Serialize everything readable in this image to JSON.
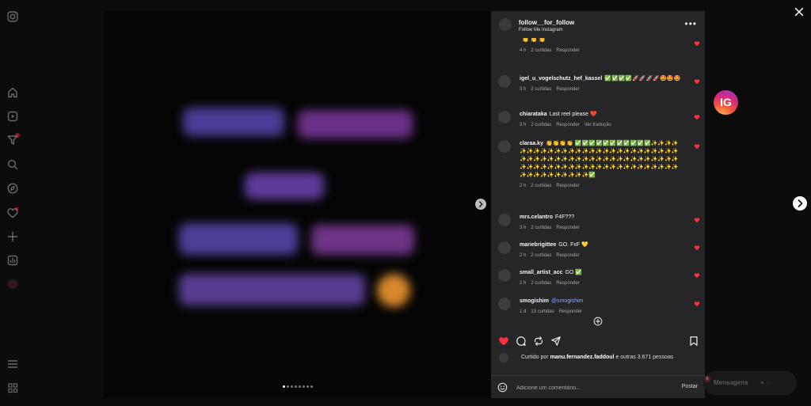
{
  "post": {
    "username": "follow__for_follow",
    "subtitle": "Follow Me Instagram",
    "media_position": {
      "current": 1,
      "total": 8
    }
  },
  "comments": [
    {
      "user": "",
      "text": "",
      "emoji": "👏 👏 👏",
      "time": "4 h",
      "likes": "2 curtidas",
      "reply": "Responder",
      "translate": ""
    },
    {
      "user": "igel_u_vogelschutz_hef_kassel",
      "text": "✅✅✅✅🚀🚀🚀🚀🤩🤩🤩",
      "emoji": "",
      "time": "3 h",
      "likes": "2 curtidas",
      "reply": "Responder",
      "translate": ""
    },
    {
      "user": "chiarataka",
      "text": "Last reel please ❤️",
      "emoji": "",
      "time": "3 h",
      "likes": "2 curtidas",
      "reply": "Responder",
      "translate": "Ver tradução"
    },
    {
      "user": "claraa.ky",
      "text": "👏👏👏👏 ✅✅✅✅✅✅✅✅✅✅✅✨✨✨✨✨✨✨✨✨✨✨✨✨✨✨✨✨✨✨✨✨✨✨✨✨✨✨✨✨✨✨✨✨✨✨✨✨✨✨✨✨✨✨✨✨✨✨✨✨✨✨✨✨✨✨✨✨✨✨✨✨✨✨✨✨✨✨✨✨✨✨✨✨✨✨✨✨✨✨✨✨✨✨✅",
      "emoji": "",
      "time": "2 h",
      "likes": "2 curtidas",
      "reply": "Responder",
      "translate": ""
    },
    {
      "user": "mrs.celantro",
      "text": "F4F???",
      "emoji": "",
      "time": "3 h",
      "likes": "2 curtidas",
      "reply": "Responder",
      "translate": ""
    },
    {
      "user": "mariebrigittee",
      "text": "GO. FxF 💛",
      "emoji": "",
      "time": "2 h",
      "likes": "2 curtidas",
      "reply": "Responder",
      "translate": ""
    },
    {
      "user": "small_artist_acc",
      "text": "GO ✅",
      "emoji": "",
      "time": "2 h",
      "likes": "2 curtidas",
      "reply": "Responder",
      "translate": ""
    },
    {
      "user": "smogishim",
      "text": "@smogishim",
      "emoji": "",
      "time": "1 d",
      "likes": "13 curtidas",
      "reply": "Responder",
      "translate": ""
    }
  ],
  "likes": {
    "prefix": "Curtido por",
    "user": "manu.fernandez.faddoul",
    "suffix": "e outras 3.671 pessoas"
  },
  "composer": {
    "placeholder": "Adicione um comentário...",
    "post_label": "Postar"
  },
  "messages": {
    "label": "Mensagens",
    "badge": "6"
  },
  "side_badge": "IG",
  "colors": {
    "like_red": "#ff3040",
    "panel_bg": "#262629",
    "muted_text": "#a8a8a8"
  }
}
